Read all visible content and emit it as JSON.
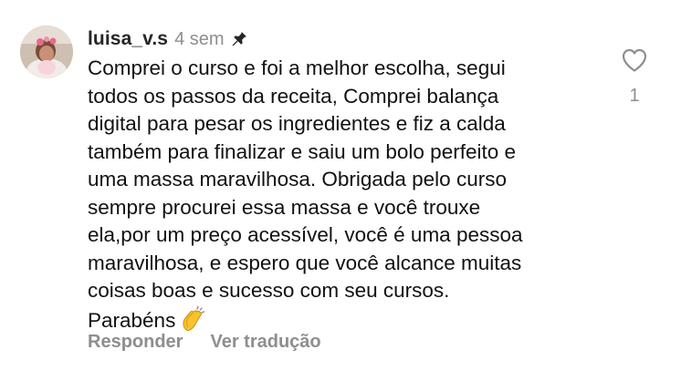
{
  "comment": {
    "username": "luisa_v.s",
    "time": "4 sem",
    "pin_icon": "pin-icon",
    "avatar": "user-avatar-photo",
    "text": "Comprei o curso e foi a melhor escolha, segui\ntodos os passos da receita, Comprei balança\ndigital para pesar os ingredientes e fiz a calda\ntambém para finalizar e saiu um bolo perfeito e\numa massa maravilhosa. Obrigada pelo curso\nsempre procurei essa massa e você trouxe\nela,por um preço acessível, você é uma pessoa\nmaravilhosa, e espero que você alcance muitas\ncoisas boas e sucesso com seu cursos.\nParabéns",
    "emoji": "clapping-hands-emoji",
    "like_icon": "heart-icon",
    "like_count": "1"
  },
  "actions": {
    "reply_label": "Responder",
    "translate_label": "Ver tradução"
  },
  "colors": {
    "username": "#262626",
    "muted": "#8e8e8e",
    "text": "#111111",
    "clap": "#f7c32e"
  }
}
